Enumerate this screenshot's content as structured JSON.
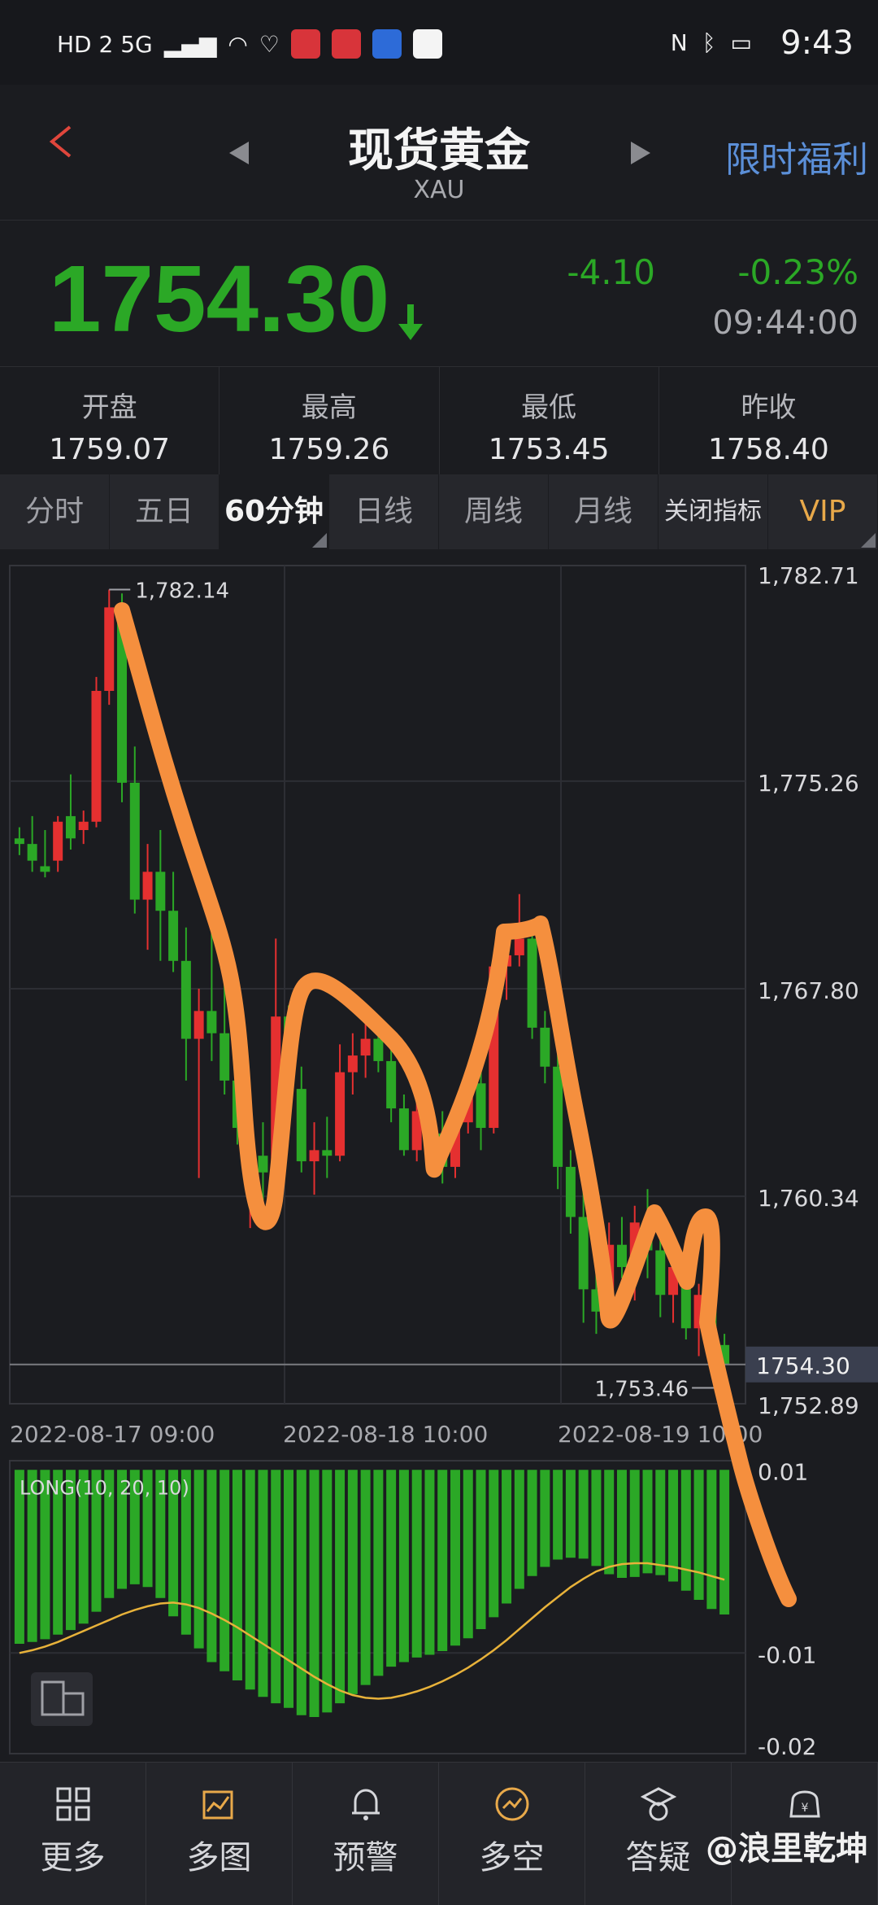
{
  "status_bar": {
    "time": "9:43",
    "network": "HD 2 5G",
    "badges": [
      "app-red-1",
      "app-red-2",
      "app-blue",
      "app-sina"
    ]
  },
  "header": {
    "title": "现货黄金",
    "subtitle": "XAU",
    "promo": "限时福利"
  },
  "quote": {
    "price": "1754.30",
    "change": "-4.10",
    "change_pct": "-0.23%",
    "time": "09:44:00",
    "color_down": "#2ba826"
  },
  "stats": [
    {
      "label": "开盘",
      "value": "1759.07"
    },
    {
      "label": "最高",
      "value": "1759.26"
    },
    {
      "label": "最低",
      "value": "1753.45"
    },
    {
      "label": "昨收",
      "value": "1758.40"
    }
  ],
  "tabs": [
    "分时",
    "五日",
    "60分钟",
    "日线",
    "周线",
    "月线",
    "关闭指标",
    "VIP"
  ],
  "active_tab": "60分钟",
  "chart_data": {
    "type": "candlestick",
    "y_ticks": [
      "1,782.71",
      "1,775.26",
      "1,767.80",
      "1,760.34",
      "1,752.89"
    ],
    "ylim": [
      1752.89,
      1782.71
    ],
    "x_ticks": [
      "2022-08-17 09:00",
      "2022-08-18 10:00",
      "2022-08-19 10:00"
    ],
    "high_label": "1,782.14",
    "low_label": "1,753.46",
    "current_label": "1754.30",
    "candles": [
      [
        1773.2,
        1773.6,
        1772.6,
        1773.0
      ],
      [
        1773.0,
        1774.0,
        1772.0,
        1772.4
      ],
      [
        1772.2,
        1773.5,
        1771.8,
        1772.0
      ],
      [
        1772.4,
        1774.0,
        1772.0,
        1773.8
      ],
      [
        1774.0,
        1775.5,
        1772.8,
        1773.2
      ],
      [
        1773.5,
        1774.2,
        1773.0,
        1773.8
      ],
      [
        1773.8,
        1779.0,
        1773.6,
        1778.5
      ],
      [
        1778.5,
        1782.14,
        1778.0,
        1781.5
      ],
      [
        1781.2,
        1782.0,
        1774.5,
        1775.2
      ],
      [
        1775.2,
        1776.5,
        1770.5,
        1771.0
      ],
      [
        1771.0,
        1773.0,
        1769.2,
        1772.0
      ],
      [
        1772.0,
        1773.5,
        1768.8,
        1770.6
      ],
      [
        1770.6,
        1772.0,
        1768.4,
        1768.8
      ],
      [
        1768.8,
        1770.0,
        1764.5,
        1766.0
      ],
      [
        1766.0,
        1767.8,
        1761.0,
        1767.0
      ],
      [
        1767.0,
        1770.5,
        1765.2,
        1766.2
      ],
      [
        1766.2,
        1768.0,
        1764.0,
        1764.5
      ],
      [
        1764.5,
        1766.2,
        1762.2,
        1762.8
      ],
      [
        1761.5,
        1763.0,
        1759.2,
        1761.8
      ],
      [
        1761.8,
        1763.0,
        1760.2,
        1761.2
      ],
      [
        1761.2,
        1769.6,
        1760.6,
        1766.8
      ],
      [
        1766.8,
        1767.2,
        1763.8,
        1764.2
      ],
      [
        1764.2,
        1765.0,
        1761.2,
        1761.6
      ],
      [
        1761.6,
        1763.0,
        1760.4,
        1762.0
      ],
      [
        1762.0,
        1763.2,
        1761.0,
        1761.8
      ],
      [
        1761.8,
        1765.8,
        1761.6,
        1764.8
      ],
      [
        1764.8,
        1766.2,
        1764.0,
        1765.4
      ],
      [
        1765.4,
        1766.6,
        1764.6,
        1766.0
      ],
      [
        1766.0,
        1766.8,
        1764.8,
        1765.2
      ],
      [
        1765.2,
        1765.8,
        1763.0,
        1763.5
      ],
      [
        1763.5,
        1764.0,
        1761.8,
        1762.0
      ],
      [
        1762.0,
        1764.2,
        1761.6,
        1763.4
      ],
      [
        1763.4,
        1764.0,
        1762.0,
        1762.6
      ],
      [
        1762.6,
        1763.4,
        1760.8,
        1761.4
      ],
      [
        1761.4,
        1763.6,
        1761.0,
        1763.0
      ],
      [
        1763.0,
        1764.8,
        1762.6,
        1764.4
      ],
      [
        1764.4,
        1766.0,
        1762.0,
        1762.8
      ],
      [
        1762.8,
        1769.0,
        1762.6,
        1768.6
      ],
      [
        1768.6,
        1769.4,
        1767.4,
        1769.0
      ],
      [
        1769.0,
        1771.2,
        1768.6,
        1769.6
      ],
      [
        1769.6,
        1770.0,
        1766.0,
        1766.4
      ],
      [
        1766.4,
        1767.0,
        1764.4,
        1765.0
      ],
      [
        1765.0,
        1765.8,
        1760.6,
        1761.4
      ],
      [
        1761.4,
        1762.0,
        1759.0,
        1759.6
      ],
      [
        1759.6,
        1761.4,
        1755.8,
        1757.0
      ],
      [
        1757.0,
        1758.6,
        1755.4,
        1756.2
      ],
      [
        1756.2,
        1759.4,
        1755.8,
        1758.6
      ],
      [
        1758.6,
        1759.6,
        1757.4,
        1757.8
      ],
      [
        1757.8,
        1760.0,
        1756.6,
        1759.4
      ],
      [
        1759.4,
        1760.6,
        1757.4,
        1758.4
      ],
      [
        1758.4,
        1759.2,
        1756.0,
        1756.8
      ],
      [
        1756.8,
        1758.4,
        1755.8,
        1757.8
      ],
      [
        1757.8,
        1758.4,
        1755.2,
        1755.6
      ],
      [
        1755.6,
        1757.2,
        1754.6,
        1756.8
      ],
      [
        1756.8,
        1757.6,
        1754.8,
        1755.0
      ],
      [
        1755.0,
        1755.4,
        1753.46,
        1754.3
      ]
    ],
    "indicator": {
      "name": "LONG(10, 20, 10)",
      "y_ticks": [
        "0.01",
        "-0.01",
        "-0.02"
      ],
      "ylim": [
        -0.021,
        0.011
      ],
      "bars": [
        -0.009,
        -0.0088,
        -0.0085,
        -0.008,
        -0.0075,
        -0.0068,
        -0.0055,
        -0.004,
        -0.003,
        -0.0025,
        -0.0028,
        -0.004,
        -0.006,
        -0.008,
        -0.0095,
        -0.011,
        -0.012,
        -0.013,
        -0.014,
        -0.0148,
        -0.0155,
        -0.016,
        -0.0168,
        -0.017,
        -0.0165,
        -0.0155,
        -0.0145,
        -0.0135,
        -0.0125,
        -0.0115,
        -0.011,
        -0.0105,
        -0.0102,
        -0.0098,
        -0.0092,
        -0.0084,
        -0.0074,
        -0.0061,
        -0.0046,
        -0.003,
        -0.0016,
        -0.0006,
        0.0002,
        0.0004,
        0.0003,
        -0.0005,
        -0.0014,
        -0.0018,
        -0.0017,
        -0.0013,
        -0.0015,
        -0.0022,
        -0.0032,
        -0.0042,
        -0.0052,
        -0.0058
      ],
      "line": [
        -0.01,
        -0.0097,
        -0.0093,
        -0.0088,
        -0.0082,
        -0.0076,
        -0.007,
        -0.0064,
        -0.0058,
        -0.0053,
        -0.0049,
        -0.0046,
        -0.0045,
        -0.0047,
        -0.0051,
        -0.0057,
        -0.0064,
        -0.0072,
        -0.0081,
        -0.009,
        -0.0099,
        -0.0108,
        -0.0117,
        -0.0126,
        -0.0134,
        -0.0141,
        -0.0146,
        -0.0149,
        -0.015,
        -0.0149,
        -0.0146,
        -0.0142,
        -0.0137,
        -0.0131,
        -0.0124,
        -0.0116,
        -0.0107,
        -0.0097,
        -0.0086,
        -0.0074,
        -0.0062,
        -0.005,
        -0.0039,
        -0.0028,
        -0.0019,
        -0.0011,
        -0.0006,
        -0.0003,
        -0.0002,
        -0.0002,
        -0.0004,
        -0.0006,
        -0.0009,
        -0.0012,
        -0.0016,
        -0.002
      ]
    },
    "up_color": "#e53030",
    "down_color": "#2ba826"
  },
  "bottom_nav": [
    {
      "label": "更多",
      "icon": "grid-icon"
    },
    {
      "label": "多图",
      "icon": "multi-chart-icon"
    },
    {
      "label": "预警",
      "icon": "bell-icon"
    },
    {
      "label": "多空",
      "icon": "trend-circle-icon"
    },
    {
      "label": "答疑",
      "icon": "qa-icon"
    },
    {
      "label": "",
      "icon": "wallet-icon"
    }
  ],
  "watermark": "@浪里乾坤"
}
